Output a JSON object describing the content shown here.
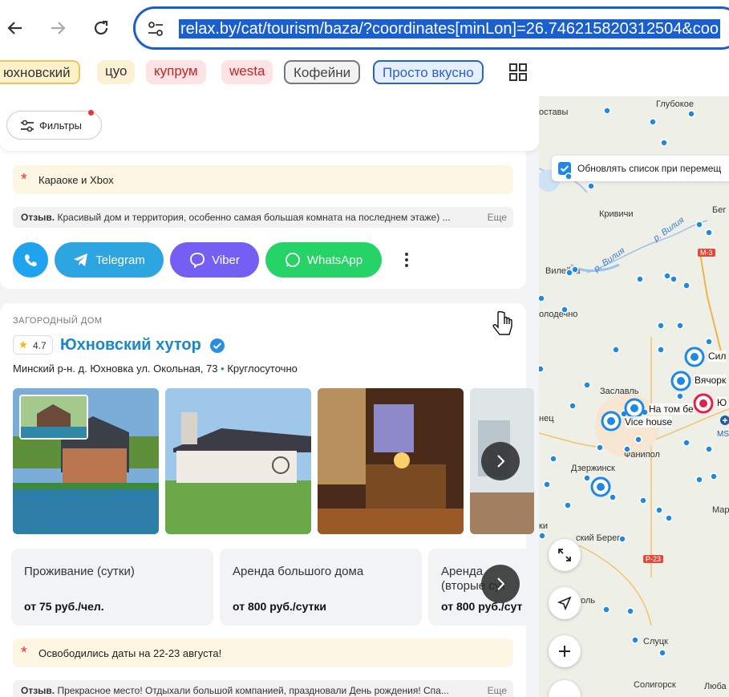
{
  "browser": {
    "url": "relax.by/cat/tourism/baza/?coordinates[minLon]=26.746215820312504&coo"
  },
  "bookmarks": [
    {
      "label": "юхновский"
    },
    {
      "label": "цуо"
    },
    {
      "label": "купрум"
    },
    {
      "label": "westa"
    },
    {
      "label": "Кофейни"
    },
    {
      "label": "Просто вкусно"
    }
  ],
  "filters": {
    "label": "Фильтры"
  },
  "card1": {
    "note": "Караоке и Xbox",
    "review_label": "Отзыв.",
    "review_text": "Красивый дом и территория, особенно самая большая комната на последнем этаже) ...",
    "more": "Еще",
    "buttons": {
      "telegram": "Telegram",
      "viber": "Viber",
      "whatsapp": "WhatsApp"
    }
  },
  "card2": {
    "category": "ЗАГОРОДНЫЙ ДОМ",
    "rating": "4.7",
    "title": "Юхновский хутор",
    "address": "Минский р-н. д. Юхновка ул. Окольная, 73",
    "hours": "Круглосуточно",
    "prices": [
      {
        "name": "Проживание (сутки)",
        "value": "от 75 руб./чел."
      },
      {
        "name": "Аренда большого дома",
        "value": "от 800 руб./сутки"
      },
      {
        "name": "Аренда (вторые сут",
        "value": "от 800 руб./сут"
      }
    ],
    "note": "Освободились даты на 22-23 августа!",
    "review_label": "Отзыв.",
    "review_text": "Прекрасное место! Отдыхали большой компанией, праздновали День рождения! Спа...",
    "more": "Еще"
  },
  "map": {
    "update_checkbox_label": "Обновлять список при перемещ",
    "labels": {
      "glubokoe": "Глубокое",
      "postavy": "оставы",
      "krivichi": "Кривичи",
      "begoml": "Бег",
      "vileyka": "Вилейка",
      "vilia1": "р. Вилия",
      "vilia2": "р. Вилия",
      "m3": "М-3",
      "molodechno": "олодечно",
      "zaslavl": "Заславль",
      "nets": "нец",
      "fanipol": "Фанипол",
      "dzerzhinsk": "Дзержинск",
      "ki": "ки",
      "bereg": "ский Берег",
      "p23": "Р-23",
      "mar": "Мар",
      "ms": "MS",
      "opol": "ополь",
      "slutsk": "Слуцк",
      "soligorsk": "Солигорск",
      "luba": "Люба"
    },
    "pins": {
      "sil": "Сил",
      "vyachorka": "Вячорк",
      "yu": "Ю",
      "natomberegu": "На том бе",
      "vicehouse": "Vice house"
    }
  }
}
